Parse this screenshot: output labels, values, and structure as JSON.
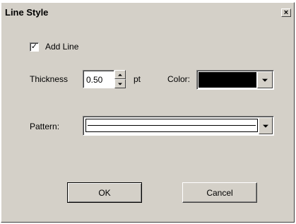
{
  "window": {
    "title": "Line Style",
    "close_glyph": "×"
  },
  "add_line": {
    "label": "Add Line",
    "checked": true,
    "check_glyph": "✓"
  },
  "thickness": {
    "label": "Thickness",
    "value": "0.50",
    "unit": "pt"
  },
  "color": {
    "label": "Color:",
    "value": "#000000"
  },
  "pattern": {
    "label": "Pattern:",
    "selected": "solid-line"
  },
  "buttons": {
    "ok": "OK",
    "cancel": "Cancel"
  }
}
